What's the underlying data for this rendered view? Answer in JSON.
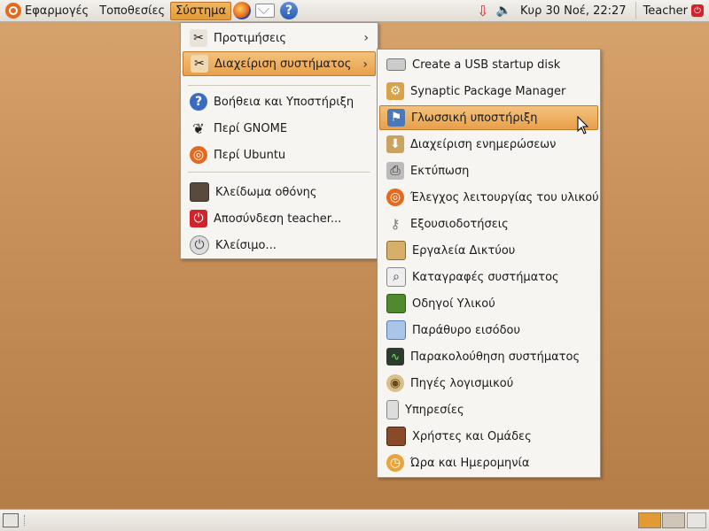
{
  "top_panel": {
    "menus": [
      "Εφαρμογές",
      "Τοποθεσίες",
      "Σύστημα"
    ],
    "launchers": [
      "firefox-icon",
      "mail-icon",
      "help-icon"
    ],
    "clock": "Κυρ 30 Νοέ, 22:27",
    "user": "Teacher"
  },
  "system_menu": {
    "items": [
      {
        "label": "Προτιμήσεις",
        "icon": "preferences-icon",
        "submenu": true
      },
      {
        "label": "Διαχείριση συστήματος",
        "icon": "administration-icon",
        "submenu": true
      },
      {
        "label": "Βοήθεια και Υποστήριξη",
        "icon": "help-icon"
      },
      {
        "label": "Περί GNOME",
        "icon": "gnome-foot-icon"
      },
      {
        "label": "Περί Ubuntu",
        "icon": "ubuntu-icon"
      },
      {
        "label": "Κλείδωμα οθόνης",
        "icon": "lock-screen-icon"
      },
      {
        "label": "Αποσύνδεση teacher...",
        "icon": "logout-icon"
      },
      {
        "label": "Κλείσιμο...",
        "icon": "shutdown-icon"
      }
    ]
  },
  "admin_submenu": {
    "items": [
      {
        "label": "Create a USB startup disk",
        "icon": "usb-disk-icon"
      },
      {
        "label": "Synaptic Package Manager",
        "icon": "synaptic-icon"
      },
      {
        "label": "Γλωσσική υποστήριξη",
        "icon": "language-flag-icon"
      },
      {
        "label": "Διαχείριση ενημερώσεων",
        "icon": "update-manager-icon"
      },
      {
        "label": "Εκτύπωση",
        "icon": "printer-icon"
      },
      {
        "label": "Έλεγχος λειτουργίας του υλικού",
        "icon": "hardware-test-icon"
      },
      {
        "label": "Εξουσιοδοτήσεις",
        "icon": "keys-icon"
      },
      {
        "label": "Εργαλεία Δικτύου",
        "icon": "network-tools-icon"
      },
      {
        "label": "Καταγραφές συστήματος",
        "icon": "system-log-icon"
      },
      {
        "label": "Οδηγοί Υλικού",
        "icon": "hardware-drivers-icon"
      },
      {
        "label": "Παράθυρο εισόδου",
        "icon": "login-window-icon"
      },
      {
        "label": "Παρακολούθηση συστήματος",
        "icon": "system-monitor-icon"
      },
      {
        "label": "Πηγές λογισμικού",
        "icon": "software-sources-icon"
      },
      {
        "label": "Υπηρεσίες",
        "icon": "services-icon"
      },
      {
        "label": "Χρήστες και Ομάδες",
        "icon": "users-groups-icon"
      },
      {
        "label": "Ώρα και Ημερομηνία",
        "icon": "time-date-icon"
      }
    ]
  }
}
